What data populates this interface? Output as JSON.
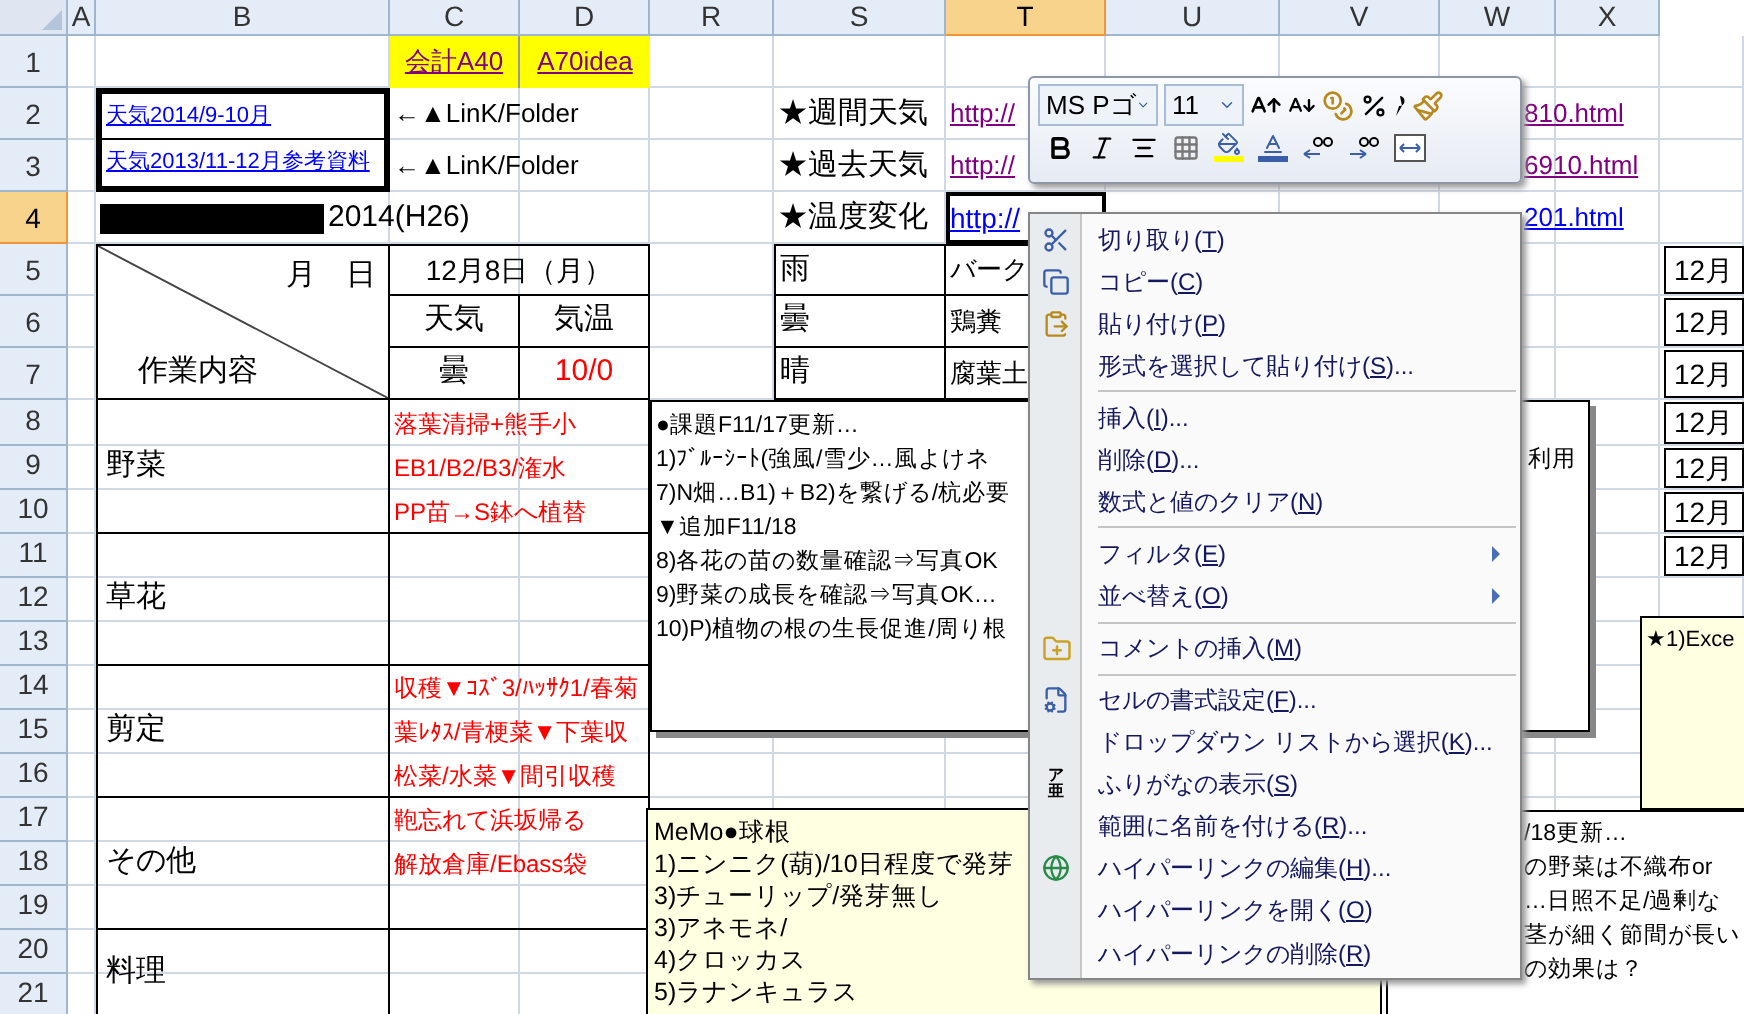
{
  "columns": [
    {
      "label": "A",
      "selected": false
    },
    {
      "label": "B",
      "selected": false
    },
    {
      "label": "C",
      "selected": false
    },
    {
      "label": "D",
      "selected": false
    },
    {
      "label": "R",
      "selected": false
    },
    {
      "label": "S",
      "selected": false
    },
    {
      "label": "T",
      "selected": true
    },
    {
      "label": "U",
      "selected": false
    },
    {
      "label": "V",
      "selected": false
    },
    {
      "label": "W",
      "selected": false
    },
    {
      "label": "X",
      "selected": false
    }
  ],
  "rows": [
    {
      "label": "1",
      "selected": false
    },
    {
      "label": "2",
      "selected": false
    },
    {
      "label": "3",
      "selected": false
    },
    {
      "label": "4",
      "selected": true
    },
    {
      "label": "5",
      "selected": false
    },
    {
      "label": "6",
      "selected": false
    },
    {
      "label": "7",
      "selected": false
    },
    {
      "label": "8",
      "selected": false
    },
    {
      "label": "9",
      "selected": false
    },
    {
      "label": "10",
      "selected": false
    },
    {
      "label": "11",
      "selected": false
    },
    {
      "label": "12",
      "selected": false
    },
    {
      "label": "13",
      "selected": false
    },
    {
      "label": "14",
      "selected": false
    },
    {
      "label": "15",
      "selected": false
    },
    {
      "label": "16",
      "selected": false
    },
    {
      "label": "17",
      "selected": false
    },
    {
      "label": "18",
      "selected": false
    },
    {
      "label": "19",
      "selected": false
    },
    {
      "label": "20",
      "selected": false
    },
    {
      "label": "21",
      "selected": false
    }
  ],
  "cells": [
    {
      "kind": "visited_link",
      "text": "会計A40",
      "selected": false
    },
    {
      "kind": "visited_link",
      "text": "A70idea",
      "selected": false
    },
    {
      "kind": "link",
      "text": "天気2014/9-10月",
      "selected": false
    },
    {
      "kind": "text",
      "text": "←▲LinK/Folder",
      "selected": false
    },
    {
      "kind": "text",
      "text": "★週間天気",
      "selected": false
    },
    {
      "kind": "visited_link",
      "text": "http://",
      "selected": false
    },
    {
      "kind": "visited_link",
      "text": "810.html",
      "selected": false
    },
    {
      "kind": "link",
      "text": "天気2013/11-12月参考資料",
      "selected": false
    },
    {
      "kind": "text",
      "text": "←▲LinK/Folder",
      "selected": false
    },
    {
      "kind": "text",
      "text": "★過去天気",
      "selected": false
    },
    {
      "kind": "visited_link",
      "text": "http://",
      "selected": false
    },
    {
      "kind": "visited_link",
      "text": "6910.html",
      "selected": false
    },
    {
      "kind": "redacted_text",
      "text": "2014(H26)",
      "selected": false
    },
    {
      "kind": "text",
      "text": "★温度変化",
      "selected": false
    },
    {
      "kind": "link",
      "text": "http://",
      "selected": true
    },
    {
      "kind": "link",
      "text": "201.html",
      "selected": false
    },
    {
      "kind": "text",
      "text": "12月8日（月）",
      "selected": false
    },
    {
      "kind": "text",
      "text": "雨",
      "selected": false
    },
    {
      "kind": "text",
      "text": "バーク",
      "selected": false
    },
    {
      "kind": "text",
      "text": "天気",
      "selected": false
    },
    {
      "kind": "text",
      "text": "気温",
      "selected": false
    },
    {
      "kind": "text",
      "text": "曇",
      "selected": false
    },
    {
      "kind": "text",
      "text": "鶏糞",
      "selected": false
    },
    {
      "kind": "text",
      "text": "曇",
      "selected": false
    },
    {
      "kind": "red_text",
      "text": "10/0",
      "selected": false
    },
    {
      "kind": "text",
      "text": "晴",
      "selected": false
    },
    {
      "kind": "text",
      "text": "腐葉土",
      "selected": false
    },
    {
      "kind": "text",
      "text": "野菜",
      "selected": false
    },
    {
      "kind": "red_text",
      "text": "落葉清掃+熊手小",
      "selected": false
    },
    {
      "kind": "red_text",
      "text": "EB1/B2/B3/潅水",
      "selected": false
    },
    {
      "kind": "red_text",
      "text": "PP苗→S鉢へ植替",
      "selected": false
    },
    {
      "kind": "text",
      "text": "草花",
      "selected": false
    },
    {
      "kind": "text",
      "text": "剪定",
      "selected": false
    },
    {
      "kind": "red_text",
      "text": "収穫▼ｺｽﾞ3/ﾊｯｻｸ1/春菊",
      "selected": false
    },
    {
      "kind": "red_text",
      "text": "葉ﾚﾀｽ/青梗菜▼下葉収",
      "selected": false
    },
    {
      "kind": "red_text",
      "text": "松菜/水菜▼間引収穫",
      "selected": false
    },
    {
      "kind": "text",
      "text": "その他",
      "selected": false
    },
    {
      "kind": "red_text",
      "text": "鞄忘れて浜坂帰る",
      "selected": false
    },
    {
      "kind": "red_text",
      "text": "解放倉庫/Ebass袋",
      "selected": false
    },
    {
      "kind": "text",
      "text": "料理",
      "selected": false
    }
  ],
  "diagonal_header": {
    "top": "月　日",
    "bottom": "作業内容"
  },
  "side_cells": [
    "12月",
    "12月",
    "12月",
    "12月",
    "12月",
    "12月",
    "12月"
  ],
  "comments": [
    {
      "kind": "note",
      "lines": [
        {
          "text": "●課題F11/17更新…"
        },
        {
          "text": "1)ﾌﾞﾙｰｼｰﾄ(強風/雪少…風よけネ",
          "tail": "利用"
        },
        {
          "text": "7)N畑…B1)＋B2)を繋げる/杭必要"
        },
        {
          "text": "▼追加F11/18"
        },
        {
          "text": "8)各花の苗の数量確認⇒写真OK"
        },
        {
          "text": "9)野菜の成長を確認⇒写真OK…"
        },
        {
          "text": "10)P)植物の根の生長促進/周り根"
        }
      ]
    },
    {
      "kind": "memo",
      "lines": [
        {
          "text": "MeMo●球根"
        },
        {
          "text": "1)ニンニク(葫)/10日程度で発芽"
        },
        {
          "text": "3)チューリップ/発芽無し"
        },
        {
          "text": "3)アネモネ/"
        },
        {
          "text": "4)クロッカス"
        },
        {
          "text": "5)ラナンキュラス"
        }
      ]
    },
    {
      "kind": "memo_small",
      "lines": [
        {
          "text": "★1)Exce"
        }
      ]
    },
    {
      "kind": "note_right",
      "lines": [
        {
          "text": "/18更新…"
        },
        {
          "text": "の野菜は不織布or"
        },
        {
          "text": "…日照不足/過剰な"
        },
        {
          "text": "茎が細く節間が長い"
        },
        {
          "text": "の効果は？"
        }
      ]
    }
  ],
  "toolbar": {
    "font": "MS Pゴ",
    "size": "11"
  },
  "context_menu": {
    "items": [
      {
        "kind": "item",
        "before": "切り取り(",
        "key": "T",
        "after": ")",
        "submenu": false
      },
      {
        "kind": "item",
        "before": "コピー(",
        "key": "C",
        "after": ")",
        "submenu": false
      },
      {
        "kind": "item",
        "before": "貼り付け(",
        "key": "P",
        "after": ")",
        "submenu": false
      },
      {
        "kind": "item",
        "before": "形式を選択して貼り付け(",
        "key": "S",
        "after": ")...",
        "submenu": false
      },
      {
        "kind": "separator"
      },
      {
        "kind": "item",
        "before": "挿入(",
        "key": "I",
        "after": ")...",
        "submenu": false
      },
      {
        "kind": "item",
        "before": "削除(",
        "key": "D",
        "after": ")...",
        "submenu": false
      },
      {
        "kind": "item",
        "before": "数式と値のクリア(",
        "key": "N",
        "after": ")",
        "submenu": false
      },
      {
        "kind": "separator"
      },
      {
        "kind": "item",
        "before": "フィルタ(",
        "key": "E",
        "after": ")",
        "submenu": true
      },
      {
        "kind": "item",
        "before": "並べ替え(",
        "key": "O",
        "after": ")",
        "submenu": true
      },
      {
        "kind": "separator"
      },
      {
        "kind": "item",
        "before": "コメントの挿入(",
        "key": "M",
        "after": ")",
        "submenu": false
      },
      {
        "kind": "separator"
      },
      {
        "kind": "item",
        "before": "セルの書式設定(",
        "key": "F",
        "after": ")...",
        "submenu": false
      },
      {
        "kind": "item",
        "before": "ドロップダウン リストから選択(",
        "key": "K",
        "after": ")...",
        "submenu": false
      },
      {
        "kind": "item",
        "before": "ふりがなの表示(",
        "key": "S",
        "after": ")",
        "submenu": false,
        "icon_text": [
          "ア",
          "亜"
        ]
      },
      {
        "kind": "item",
        "before": "範囲に名前を付ける(",
        "key": "R",
        "after": ")...",
        "submenu": false
      },
      {
        "kind": "item",
        "before": "ハイパーリンクの編集(",
        "key": "H",
        "after": ")...",
        "submenu": false
      },
      {
        "kind": "item",
        "before": "ハイパーリンクを開く(",
        "key": "O",
        "after": ")",
        "submenu": false
      },
      {
        "kind": "item",
        "before": "ハイパーリンクの削除(",
        "key": "R",
        "after": ")",
        "submenu": false
      }
    ]
  }
}
